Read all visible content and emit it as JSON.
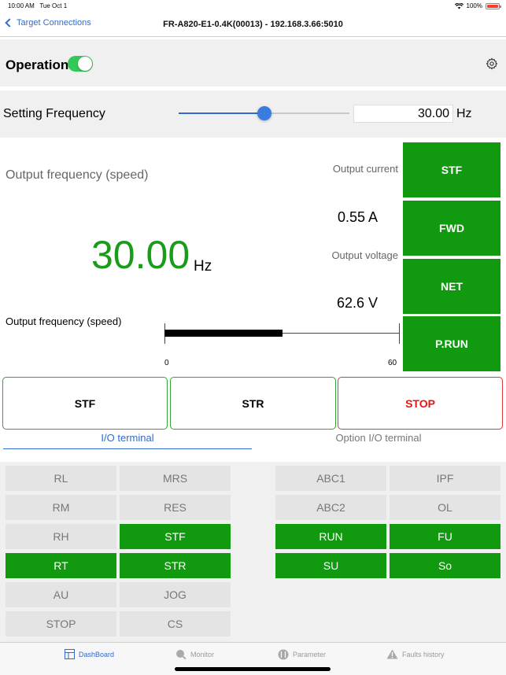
{
  "status": {
    "time": "10:00 AM",
    "date": "Tue Oct 1",
    "battery": "100%"
  },
  "nav": {
    "back_label": "Target Connections",
    "title": "FR-A820-E1-0.4K(00013) - 192.168.3.66:5010"
  },
  "operation": {
    "label": "Operation",
    "enabled": true
  },
  "setting": {
    "label": "Setting Frequency",
    "value": "30.00",
    "unit": "Hz",
    "slider_fraction": 0.5
  },
  "monitor": {
    "title": "Output frequency (speed)",
    "value": "30.00",
    "unit": "Hz",
    "bar_label": "Output frequency (speed)",
    "bar_min": "0",
    "bar_max": "60",
    "bar_fraction": 0.5,
    "current_label": "Output current",
    "current_value": "0.55 A",
    "voltage_label": "Output voltage",
    "voltage_value": "62.6 V"
  },
  "status_flags": [
    "STF",
    "FWD",
    "NET",
    "P.RUN"
  ],
  "commands": {
    "stf": "STF",
    "str": "STR",
    "stop": "STOP"
  },
  "tabs": {
    "io": "I/O terminal",
    "option_io": "Option I/O terminal"
  },
  "inputs": [
    {
      "label": "RL",
      "on": false
    },
    {
      "label": "MRS",
      "on": false
    },
    {
      "label": "RM",
      "on": false
    },
    {
      "label": "RES",
      "on": false
    },
    {
      "label": "RH",
      "on": false
    },
    {
      "label": "STF",
      "on": true
    },
    {
      "label": "RT",
      "on": true
    },
    {
      "label": "STR",
      "on": true
    },
    {
      "label": "AU",
      "on": false
    },
    {
      "label": "JOG",
      "on": false
    },
    {
      "label": "STOP",
      "on": false
    },
    {
      "label": "CS",
      "on": false
    }
  ],
  "outputs": [
    {
      "label": "ABC1",
      "on": false
    },
    {
      "label": "IPF",
      "on": false
    },
    {
      "label": "ABC2",
      "on": false
    },
    {
      "label": "OL",
      "on": false
    },
    {
      "label": "RUN",
      "on": true
    },
    {
      "label": "FU",
      "on": true
    },
    {
      "label": "SU",
      "on": true
    },
    {
      "label": "So",
      "on": true
    }
  ],
  "tabbar": {
    "dashboard": "DashBoard",
    "monitor": "Monitor",
    "parameter": "Parameter",
    "faults": "Faults history"
  },
  "colors": {
    "accent": "#2f6bd0",
    "on": "#119a10",
    "stop": "#e11111",
    "value_green": "#1a9b1a"
  }
}
